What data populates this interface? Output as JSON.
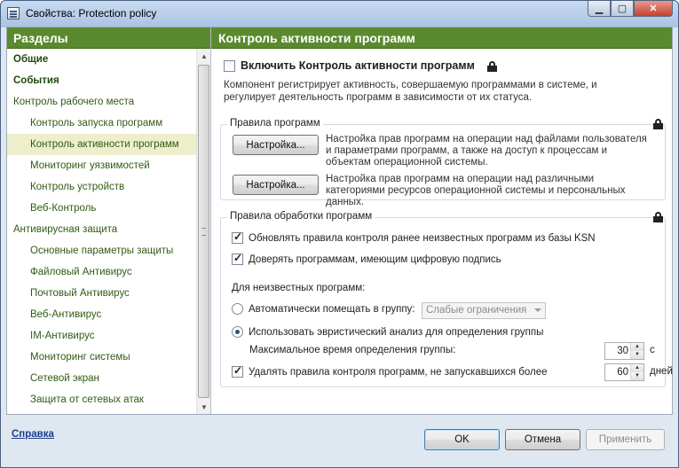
{
  "window": {
    "title": "Свойства: Protection policy"
  },
  "sidebar": {
    "header": "Разделы",
    "items": [
      {
        "label": "Общие",
        "style": "bold"
      },
      {
        "label": "События",
        "style": "bold"
      },
      {
        "label": "Контроль рабочего места",
        "style": "top"
      },
      {
        "label": "Контроль запуска программ",
        "style": "sub"
      },
      {
        "label": "Контроль активности программ",
        "style": "sub",
        "selected": true
      },
      {
        "label": "Мониторинг уязвимостей",
        "style": "sub"
      },
      {
        "label": "Контроль устройств",
        "style": "sub"
      },
      {
        "label": "Веб-Контроль",
        "style": "sub"
      },
      {
        "label": "Антивирусная защита",
        "style": "top"
      },
      {
        "label": "Основные параметры защиты",
        "style": "sub"
      },
      {
        "label": "Файловый Антивирус",
        "style": "sub"
      },
      {
        "label": "Почтовый Антивирус",
        "style": "sub"
      },
      {
        "label": "Веб-Антивирус",
        "style": "sub"
      },
      {
        "label": "IM-Антивирус",
        "style": "sub"
      },
      {
        "label": "Мониторинг системы",
        "style": "sub"
      },
      {
        "label": "Сетевой экран",
        "style": "sub"
      },
      {
        "label": "Защита от сетевых атак",
        "style": "sub"
      }
    ]
  },
  "main": {
    "header": "Контроль активности программ",
    "enable_label": "Включить Контроль активности программ",
    "description": "Компонент регистрирует активность, совершаемую программами в системе, и регулирует деятельность программ в зависимости от их статуса.",
    "rules_group": {
      "title": "Правила программ",
      "button1_label": "Настройка...",
      "button1_desc": "Настройка прав программ на операции над файлами пользователя и параметрами программ, а также на доступ к процессам и объектам операционной системы.",
      "button2_label": "Настройка...",
      "button2_desc": "Настройка прав программ на операции над различными категориями ресурсов операционной системы и персональных данных."
    },
    "processing_group": {
      "title": "Правила обработки программ",
      "update_rules_label": "Обновлять правила контроля ранее неизвестных программ из базы KSN",
      "trust_signed_label": "Доверять программам, имеющим цифровую подпись",
      "unknown_label": "Для неизвестных программ:",
      "auto_group_label": "Автоматически помещать в группу:",
      "auto_group_value": "Слабые ограничения",
      "heuristic_label": "Использовать эвристический анализ для определения группы",
      "max_time_label": "Максимальное время определения группы:",
      "max_time_value": "30",
      "max_time_unit": "с",
      "delete_rules_label": "Удалять правила контроля программ, не запускавшихся более",
      "delete_days_value": "60",
      "delete_days_unit": "дней"
    }
  },
  "footer": {
    "help_label": "Справка",
    "ok_label": "OK",
    "cancel_label": "Отмена",
    "apply_label": "Применить"
  }
}
